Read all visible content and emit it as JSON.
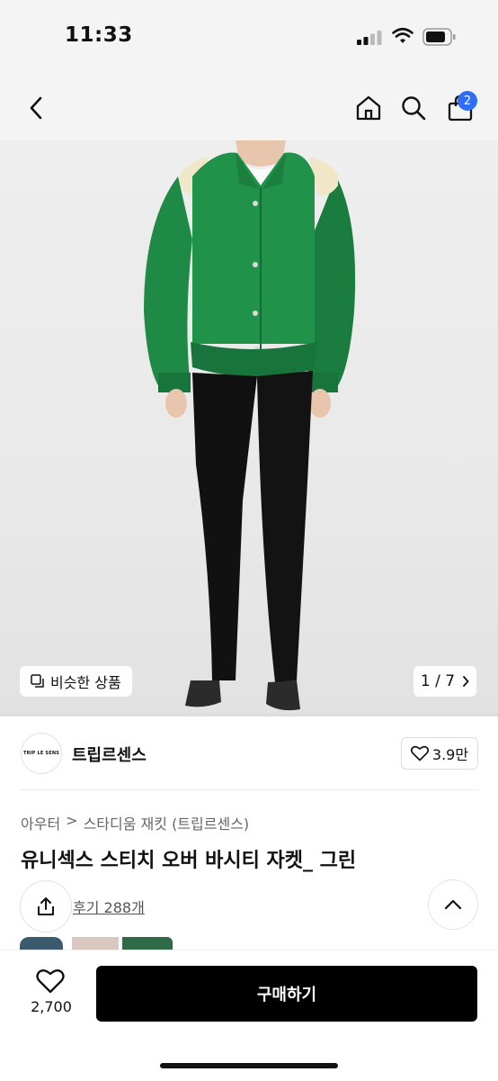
{
  "status_bar": {
    "time": "11:33"
  },
  "header": {
    "cart_count": "2"
  },
  "gallery": {
    "similar_label": "비슷한 상품",
    "page_counter": "1 / 7"
  },
  "brand": {
    "logo_text": "TRIP LE SENS",
    "name": "트립르센스",
    "likes": "3.9만"
  },
  "product": {
    "breadcrumb_category": "아우터",
    "breadcrumb_separator": ">",
    "breadcrumb_sub": "스타디움 재킷 (트립르센스)",
    "title": "유니섹스 스티치 오버 바시티 자켓_ 그린",
    "reviews_label": "후기 288개"
  },
  "bottom_bar": {
    "like_count": "2,700",
    "buy_label": "구매하기"
  },
  "colors": {
    "accent": "#2f6df6",
    "jacket_green": "#1f8a46",
    "button_black": "#000000"
  },
  "icons": [
    "back-icon",
    "home-icon",
    "search-icon",
    "cart-icon",
    "similar-icon",
    "chevron-right-icon",
    "heart-icon",
    "share-icon",
    "chevron-up-icon"
  ]
}
